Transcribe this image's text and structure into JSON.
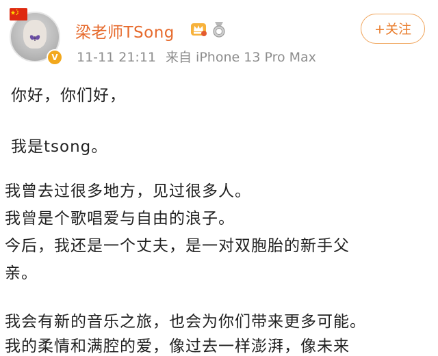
{
  "post": {
    "username": "梁老师TSong",
    "time": "11-11 21:11",
    "source": "来自 iPhone 13 Pro Max",
    "follow_label": "+关注",
    "verified_mark": "V",
    "lines": [
      "你好，你们好，",
      "我是tsong。",
      "我曾去过很多地方，见过很多人。",
      "我曾是个歌唱爱与自由的浪子。",
      "今后，我还是一个丈夫，是一对双胞胎的新手父",
      "亲。",
      "我会有新的音乐之旅，也会为你们带来更多可能。",
      "我的柔情和满腔的爱，像过去一样澎湃，像未来"
    ]
  },
  "colors": {
    "username": "#e66a2c",
    "follow_border": "#f0a45a",
    "meta_text": "#8c8c8c",
    "body_text": "#222222",
    "verified_badge": "#f2a81d"
  },
  "icons": {
    "flag": "china-flag-icon",
    "verified": "verified-badge-icon",
    "crown": "crown-badge-icon",
    "medal": "medal-badge-icon"
  }
}
